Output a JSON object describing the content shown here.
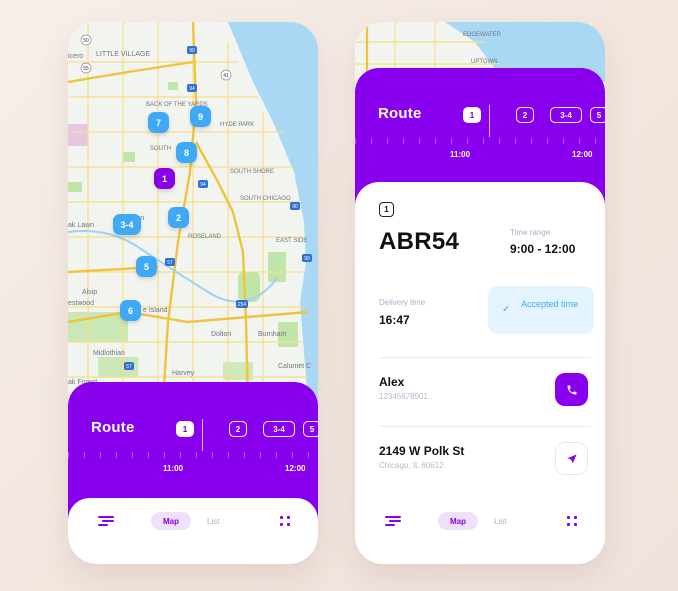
{
  "map_screen": {
    "map_labels": [
      "icero",
      "LITTLE VILLAGE",
      "BACK OF THE YARDS",
      "HYDE PARK",
      "SOUTH",
      "SOUTH SHORE",
      "SOUTH CHICAGO",
      "ak Lawn",
      "ergreen",
      "ROSELAND",
      "EAST SIDE",
      "Alsip",
      "estwood",
      "e Island",
      "Dolton",
      "Burnham",
      "Midlothian",
      "Harvey",
      "Calumet C",
      "ak Forest"
    ],
    "highway_shields": [
      "50",
      "55",
      "90",
      "94",
      "41",
      "57",
      "94",
      "294",
      "90",
      "57",
      "90"
    ],
    "pins": [
      "7",
      "9",
      "8",
      "1",
      "2",
      "3-4",
      "5",
      "6"
    ],
    "active_pin": "1",
    "route": {
      "title": "Route",
      "steps": [
        "1",
        "2",
        "3-4",
        "5"
      ],
      "selected_step": "1",
      "time_start": "11:00",
      "time_end": "12:00"
    },
    "bottom_nav": {
      "map": "Map",
      "list": "List"
    }
  },
  "detail_screen": {
    "map_labels": [
      "EDGEWATER",
      "UPTOWN"
    ],
    "route": {
      "title": "Route",
      "steps": [
        "1",
        "2",
        "3-4",
        "5"
      ],
      "selected_step": "1",
      "time_start": "11:00",
      "time_end": "12:00"
    },
    "order": {
      "badge": "1",
      "code": "ABR54",
      "time_range_label": "Time range",
      "time_range": "9:00 - 12:00",
      "delivery_time_label": "Delivery time",
      "delivery_time": "16:47",
      "status": "Accepted time"
    },
    "contact": {
      "name": "Alex",
      "phone": "12345678901"
    },
    "address": {
      "street": "2149 W Polk St",
      "city": "Chicago, IL 60612"
    },
    "bottom_nav": {
      "map": "Map",
      "list": "List"
    }
  },
  "colors": {
    "accent": "#8800ee",
    "pin": "#3fa9f5",
    "map_land": "#f2f4ef",
    "map_water": "#a9d8f5",
    "map_park": "#bfe5a8",
    "road": "#f4d35e"
  },
  "icons": [
    "phone-icon",
    "navigation-arrow-icon",
    "menu-icon",
    "grid-icon",
    "check-icon"
  ]
}
